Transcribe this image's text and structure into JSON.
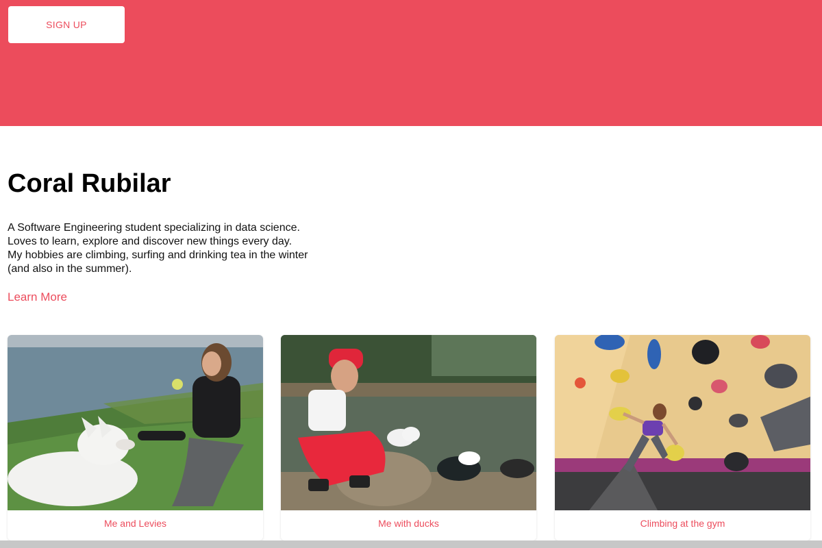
{
  "hero": {
    "background_color": "#ec4c5c",
    "signup_label": "SIGN UP"
  },
  "profile": {
    "name": "Coral Rubilar",
    "bio_lines": [
      "A Software Engineering student specializing in data science.",
      "Loves to learn, explore and discover new things every day.",
      "My hobbies are climbing, surfing and drinking tea in the winter",
      "(and also in the summer)."
    ],
    "learn_more_label": "Learn More"
  },
  "cards": [
    {
      "caption": "Me and Levies",
      "image": "photo-woman-with-white-dog-by-sea"
    },
    {
      "caption": "Me with ducks",
      "image": "photo-woman-with-ducks-at-pond"
    },
    {
      "caption": "Climbing at the gym",
      "image": "photo-climbing-wall"
    }
  ],
  "colors": {
    "accent": "#ec4c5c",
    "text": "#111111",
    "footer_bar": "#c7c7c7"
  }
}
